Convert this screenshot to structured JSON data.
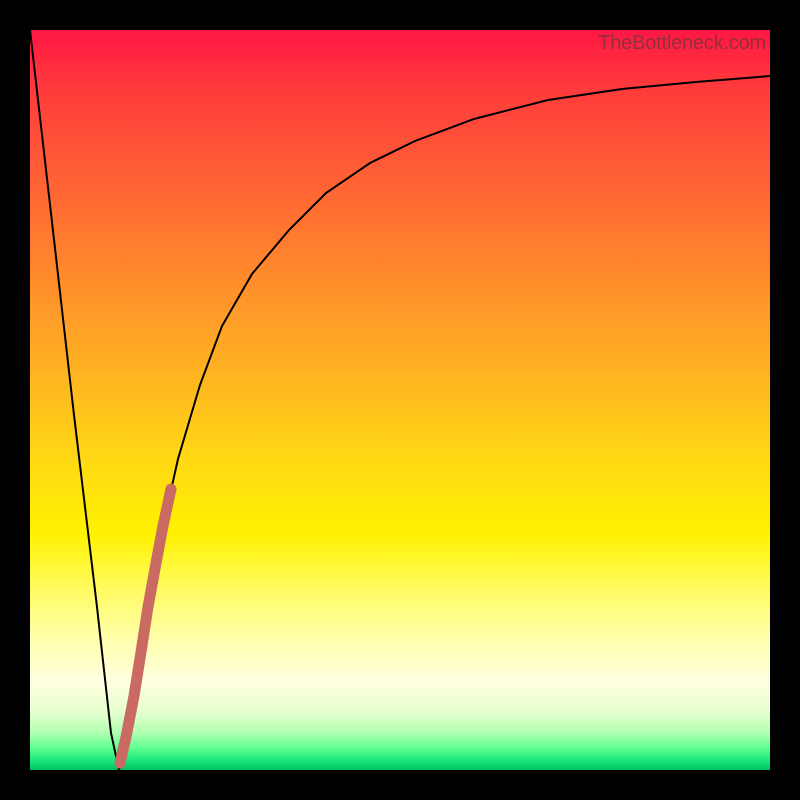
{
  "watermark": "TheBottleneck.com",
  "colors": {
    "curve_stroke": "#000000",
    "highlight_stroke": "#c96a63",
    "background_frame": "#000000"
  },
  "chart_data": {
    "type": "line",
    "title": "",
    "xlabel": "",
    "ylabel": "",
    "xlim": [
      0,
      100
    ],
    "ylim": [
      0,
      100
    ],
    "grid": false,
    "legend": false,
    "series": [
      {
        "name": "bottleneck-curve",
        "x": [
          0,
          3,
          6,
          9,
          11,
          12,
          13,
          14,
          16,
          18,
          20,
          23,
          26,
          30,
          35,
          40,
          46,
          52,
          60,
          70,
          80,
          90,
          100
        ],
        "y": [
          100,
          74,
          48,
          22,
          5,
          0,
          4,
          10,
          22,
          33,
          42,
          52,
          60,
          67,
          73,
          78,
          82,
          85,
          88,
          90.5,
          92,
          93,
          93.8
        ]
      },
      {
        "name": "highlight-segment",
        "x": [
          12.2,
          13,
          14,
          15,
          16,
          17,
          18,
          19
        ],
        "y": [
          1,
          4.5,
          10,
          16,
          22,
          28,
          33,
          38
        ]
      }
    ]
  }
}
